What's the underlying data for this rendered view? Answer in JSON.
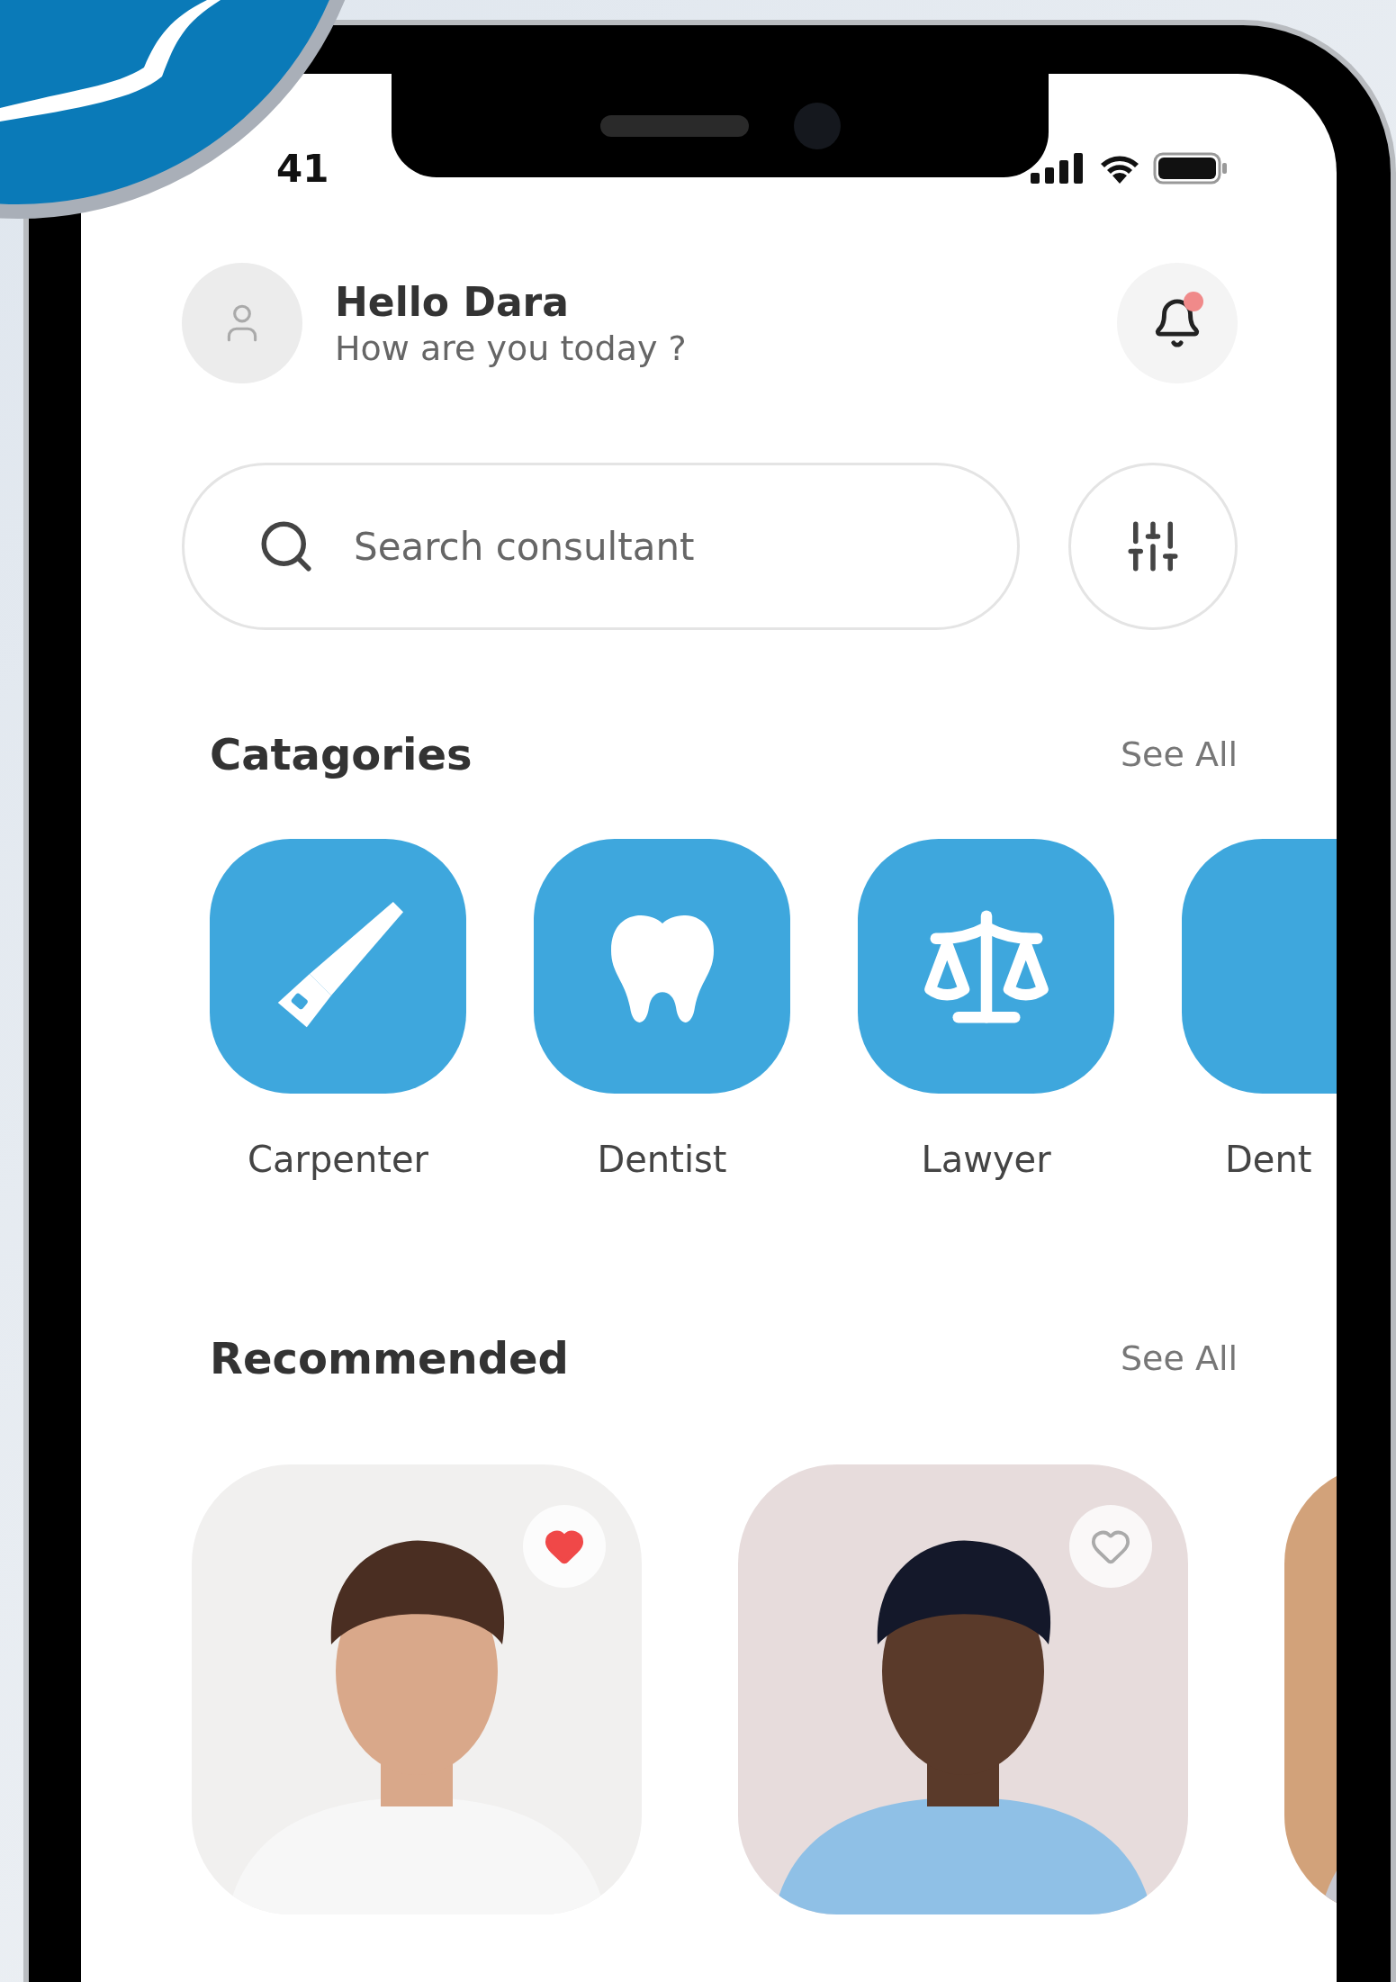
{
  "status_bar": {
    "time": "41"
  },
  "header": {
    "greeting": "Hello Dara",
    "subtitle": "How are you today ?",
    "notification": {
      "unread": true
    }
  },
  "search": {
    "placeholder": "Search consultant"
  },
  "categories": {
    "title": "Catagories",
    "see_all": "See All",
    "items": [
      {
        "label": "Carpenter",
        "kind": "saw"
      },
      {
        "label": "Dentist",
        "kind": "tooth"
      },
      {
        "label": "Lawyer",
        "kind": "scale"
      },
      {
        "label": "Dent",
        "kind": "blank"
      }
    ]
  },
  "recommended": {
    "title": "Recommended",
    "see_all": "See All",
    "items": [
      {
        "kind": "picture",
        "favorite": true
      },
      {
        "kind": "picture",
        "favorite": false
      },
      {
        "kind": "picture"
      }
    ]
  }
}
